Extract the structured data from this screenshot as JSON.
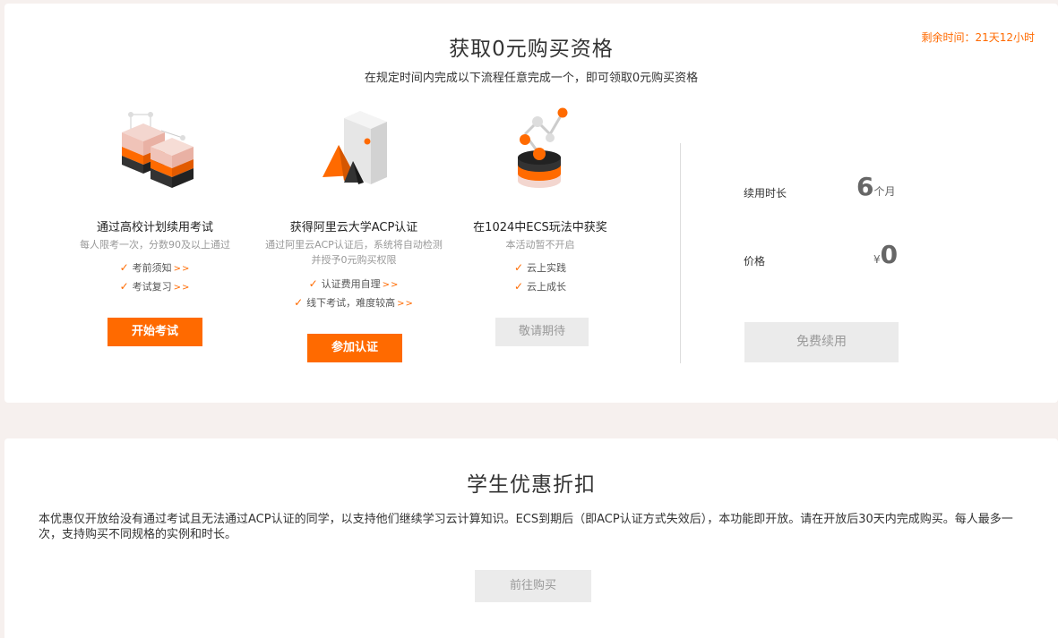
{
  "acquire": {
    "title": "获取0元购买资格",
    "subtitle": "在规定时间内完成以下流程任意完成一个，即可领取0元购买资格",
    "remaining_time": "剩余时间：21天12小时",
    "steps": [
      {
        "illustration": "stacked-cubes-icon",
        "title": "通过高校计划续用考试",
        "desc": "每人限考一次，分数90及以上通过",
        "checks": [
          {
            "label": "考前须知",
            "arrows": ">>"
          },
          {
            "label": "考试复习",
            "arrows": ">>"
          }
        ],
        "button": "开始考试",
        "button_state": "active"
      },
      {
        "illustration": "cone-and-box-icon",
        "title": "获得阿里云大学ACP认证",
        "desc": "通过阿里云ACP认证后，系统将自动检测并授予0元购买权限",
        "checks": [
          {
            "label": "认证费用自理",
            "arrows": ">>"
          },
          {
            "label": "线下考试，难度较高",
            "arrows": ">>"
          }
        ],
        "button": "参加认证",
        "button_state": "active"
      },
      {
        "illustration": "molecule-stack-icon",
        "title": "在1024中ECS玩法中获奖",
        "desc": "本活动暂不开启",
        "checks": [
          {
            "label": "云上实践",
            "arrows": ""
          },
          {
            "label": "云上成长",
            "arrows": ""
          }
        ],
        "button": "敬请期待",
        "button_state": "disabled"
      }
    ],
    "renewal": {
      "duration_label": "续用时长",
      "duration_value": "6",
      "duration_unit": "个月",
      "price_label": "价格",
      "currency": "¥",
      "price_value": "0",
      "button": "免费续用"
    }
  },
  "discount": {
    "title": "学生优惠折扣",
    "description": "本优惠仅开放给没有通过考试且无法通过ACP认证的同学，以支持他们继续学习云计算知识。ECS到期后（即ACP认证方式失效后），本功能即开放。请在开放后30天内完成购买。每人最多一次，支持购买不同规格的实例和时长。",
    "button": "前往购买"
  },
  "colors": {
    "accent": "#ff6a00",
    "disabled_bg": "#ebebeb",
    "page_bg": "#f6f0ee"
  }
}
